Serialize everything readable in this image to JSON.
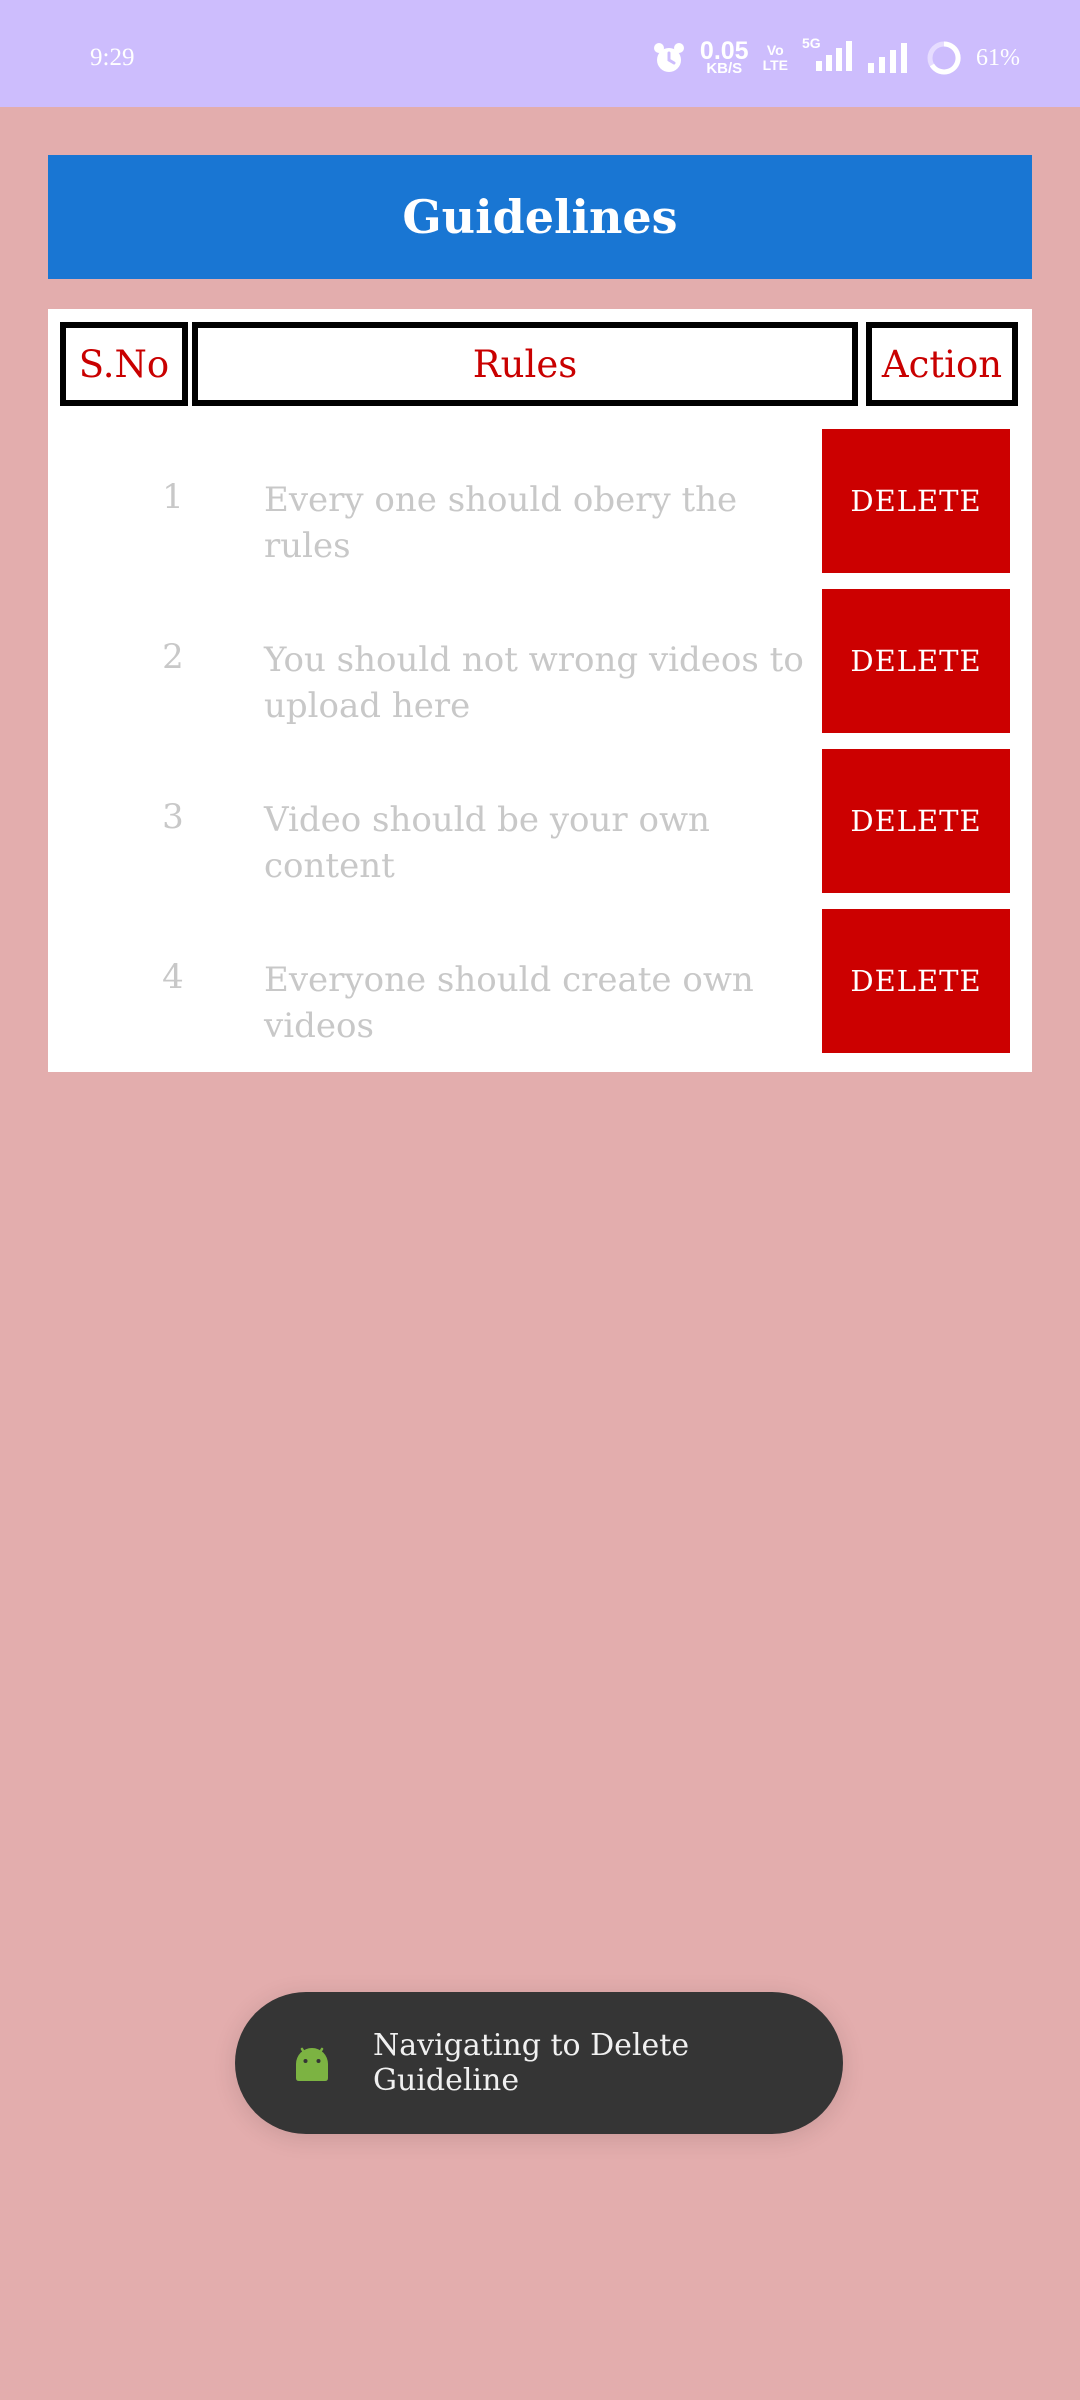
{
  "status_bar": {
    "time": "9:29",
    "net_speed_value": "0.05",
    "net_speed_unit": "KB/S",
    "volte_label_top": "Vo",
    "volte_label_bottom": "LTE",
    "network_type": "5G",
    "battery_percent": "61%"
  },
  "header": {
    "title": "Guidelines",
    "background": "#1976d3"
  },
  "table": {
    "columns": {
      "sno": "S.No",
      "rules": "Rules",
      "action": "Action"
    },
    "rows": [
      {
        "sno": "1",
        "rule": "Every one should obery the rules",
        "action": "DELETE"
      },
      {
        "sno": "2",
        "rule": "You should not wrong videos to upload here",
        "action": "DELETE"
      },
      {
        "sno": "3",
        "rule": "Video should be your own content",
        "action": "DELETE"
      },
      {
        "sno": "4",
        "rule": "Everyone should create own videos",
        "action": "DELETE"
      }
    ]
  },
  "toast": {
    "message": "Navigating to Delete Guideline",
    "icon": "android-icon"
  },
  "colors": {
    "page_background": "#e3adad",
    "status_bar": "#cdbdfd",
    "header_text_accent": "#c90000",
    "delete_button": "#cc0000"
  }
}
